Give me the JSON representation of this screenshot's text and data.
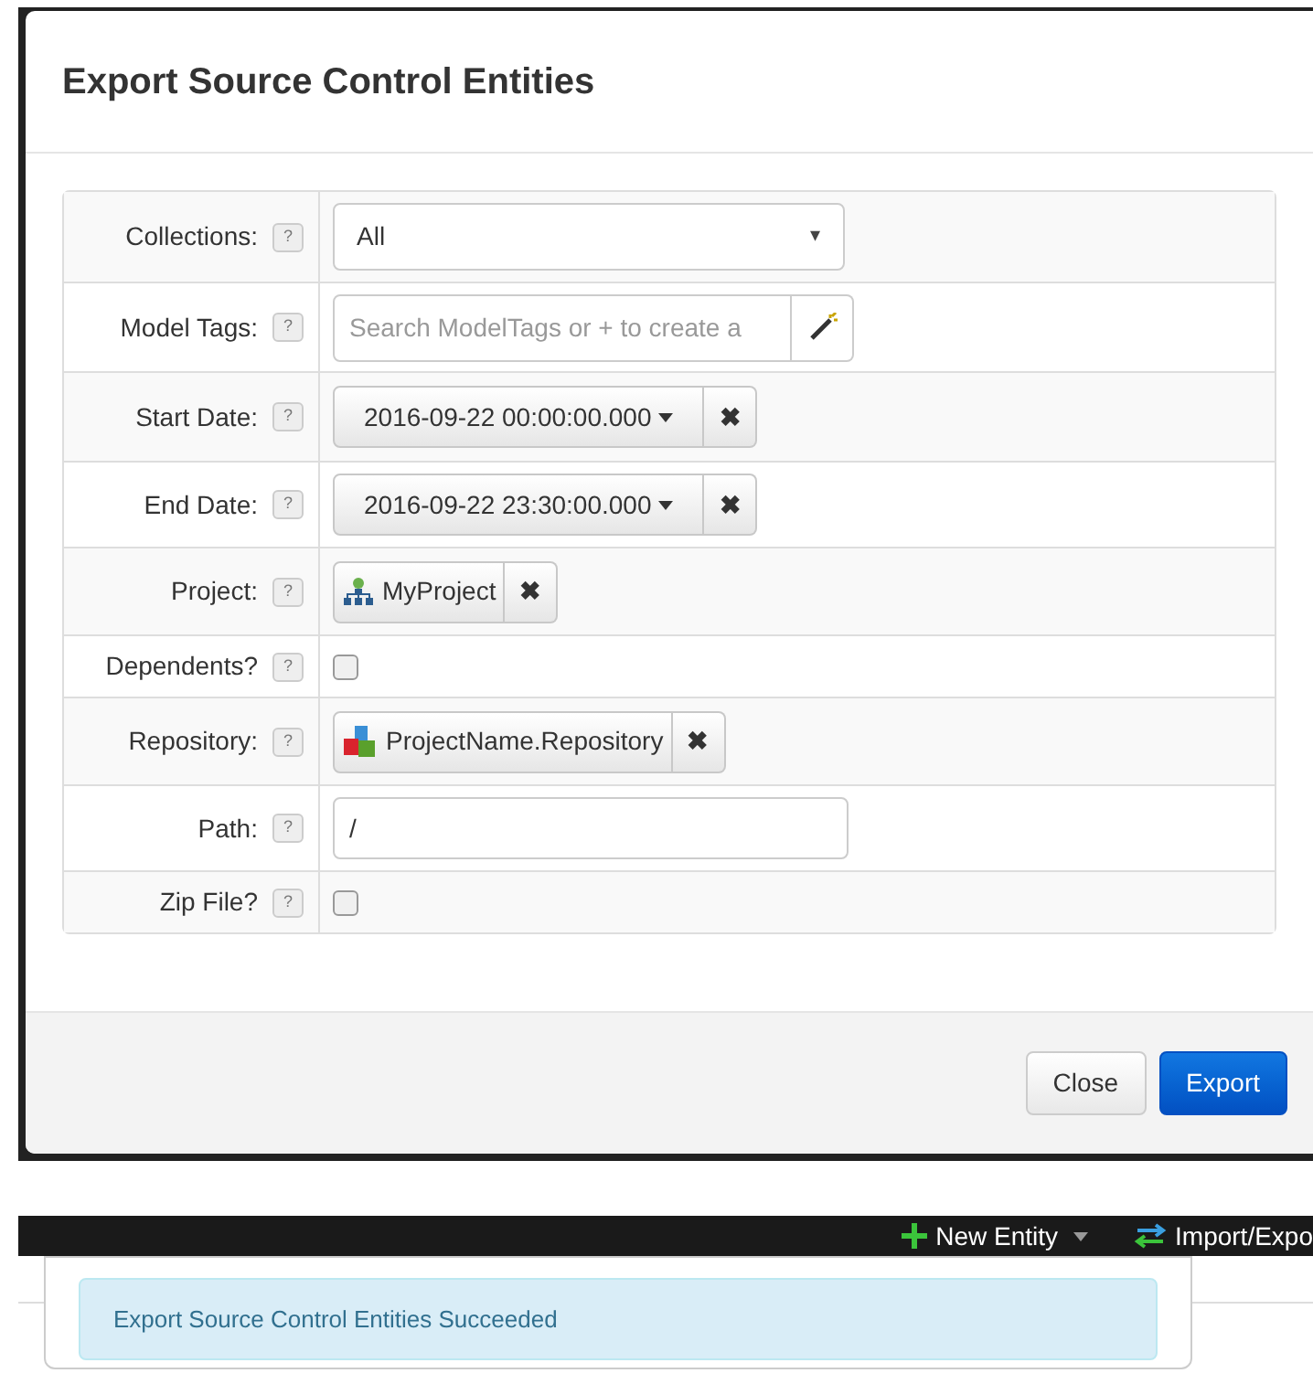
{
  "dialog": {
    "title": "Export Source Control Entities",
    "fields": [
      {
        "kind": "select",
        "label": "Collections:",
        "help": "?",
        "value": "All",
        "caret": "▾"
      },
      {
        "kind": "tags",
        "label": "Model Tags:",
        "help": "?",
        "placeholder": "Search ModelTags or + to create a"
      },
      {
        "kind": "date",
        "label": "Start Date:",
        "help": "?",
        "value": "2016-09-22 00:00:00.000",
        "remove": "✖"
      },
      {
        "kind": "date",
        "label": "End Date:",
        "help": "?",
        "value": "2016-09-22 23:30:00.000",
        "remove": "✖"
      },
      {
        "kind": "chip",
        "label": "Project:",
        "help": "?",
        "value": "MyProject",
        "remove": "✖"
      },
      {
        "kind": "checkbox",
        "label": "Dependents?",
        "help": "?",
        "checked": false
      },
      {
        "kind": "chip",
        "label": "Repository:",
        "help": "?",
        "value": "ProjectName.Repository",
        "remove": "✖"
      },
      {
        "kind": "text",
        "label": "Path:",
        "help": "?",
        "value": "/"
      },
      {
        "kind": "checkbox",
        "label": "Zip File?",
        "help": "?",
        "checked": false
      }
    ],
    "buttons": [
      {
        "label": "Close",
        "primary": false
      },
      {
        "label": "Export",
        "primary": true
      }
    ]
  },
  "toolbar": {
    "items": [
      {
        "label": "New Entity",
        "dropdown": true
      },
      {
        "label": "Import/Expo",
        "dropdown": false
      }
    ]
  },
  "notification": {
    "message": "Export Source Control Entities Succeeded"
  }
}
